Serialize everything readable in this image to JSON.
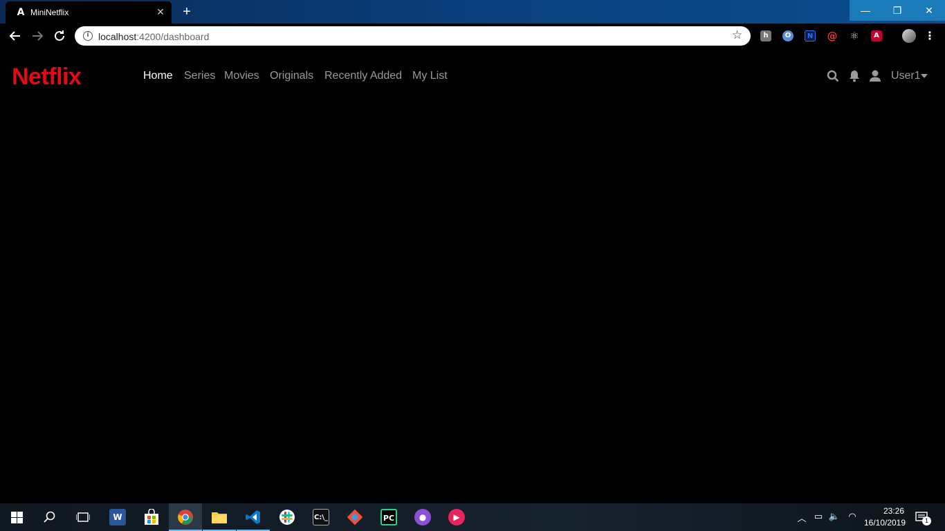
{
  "browser": {
    "tab_title": "MiniNetflix",
    "tab_favicon": "A",
    "tab_close": "✕",
    "new_tab": "+",
    "window_controls": {
      "minimize": "—",
      "maximize": "❐",
      "close": "✕"
    },
    "url_host": "localhost",
    "url_path": ":4200/dashboard",
    "extensions": [
      {
        "icon": "hackernews-icon",
        "glyph": "h"
      },
      {
        "icon": "circle-o-icon",
        "glyph": "O"
      },
      {
        "icon": "n-ext-icon",
        "glyph": "N"
      },
      {
        "icon": "spiral-ext-icon",
        "glyph": "@"
      },
      {
        "icon": "react-devtools-icon",
        "glyph": "⚛"
      },
      {
        "icon": "angular-augury-icon",
        "glyph": "A"
      },
      {
        "icon": "profile-avatar-icon",
        "glyph": ""
      },
      {
        "icon": "more-menu-icon",
        "glyph": "⋮"
      }
    ]
  },
  "app": {
    "logo": "Netflix",
    "nav": [
      "Home",
      "Series",
      "Movies",
      "Originals",
      "Recently Added",
      "My List"
    ],
    "active_nav": "Home",
    "user_label": "User1"
  },
  "colors": {
    "brand": "#e50914",
    "nav_inactive": "#9a9a9a",
    "nav_active": "#ffffff",
    "background": "#000000"
  },
  "taskbar": {
    "apps": [
      "start-icon",
      "search-icon",
      "task-view-icon",
      "word-icon",
      "store-icon",
      "chrome-icon",
      "file-explorer-icon",
      "vscode-icon",
      "slack-icon",
      "terminal-icon",
      "git-icon",
      "pycharm-icon",
      "github-desktop-icon",
      "media-player-icon"
    ],
    "time": "23:26",
    "date": "16/10/2019",
    "notification_count": "1"
  }
}
